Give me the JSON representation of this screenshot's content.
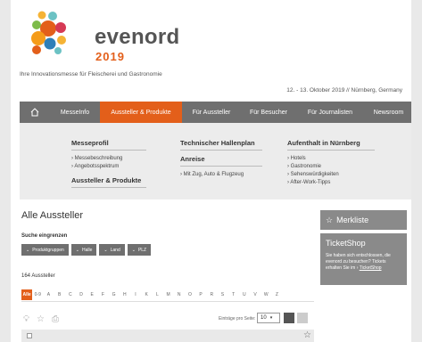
{
  "brand": {
    "name": "evenord",
    "year": "2019",
    "tagline": "Ihre Innovationsmesse für Fleischerei und Gastronomie",
    "dates": "12. - 13. Oktober 2019 // Nürnberg, Germany"
  },
  "nav": {
    "items": [
      "MesseInfo",
      "Aussteller & Produkte",
      "Für Aussteller",
      "Für Besucher",
      "Für Journalisten",
      "Newsroom"
    ]
  },
  "mega": {
    "col1": {
      "title": "Messeprofil",
      "links": [
        "Messebeschreibung",
        "Angebotsspektrum"
      ],
      "title2": "Aussteller & Produkte"
    },
    "col2": {
      "title": "Technischer Hallenplan",
      "title2": "Anreise",
      "links": [
        "Mit Zug, Auto & Flugzeug"
      ]
    },
    "col3": {
      "title": "Aufenthalt in Nürnberg",
      "links": [
        "Hotels",
        "Gastronomie",
        "Sehenswürdigkeiten",
        "After-Work-Tipps"
      ]
    }
  },
  "main": {
    "title": "Alle Aussteller",
    "filter_label": "Suche eingrenzen",
    "filters": [
      "Produktgruppen",
      "Halle",
      "Land",
      "PLZ"
    ],
    "count": "164 Aussteller",
    "alphabet": [
      "Alle",
      "0-9",
      "A",
      "B",
      "C",
      "D",
      "E",
      "F",
      "G",
      "H",
      "I",
      "K",
      "L",
      "M",
      "N",
      "O",
      "P",
      "R",
      "S",
      "T",
      "U",
      "V",
      "W",
      "Z"
    ],
    "per_page_label": "Einträge pro Seite:",
    "per_page_value": "10"
  },
  "sidebar": {
    "merkliste": "Merkliste",
    "ticket_title": "TicketShop",
    "ticket_text": "Sie haben sich entschlossen, die evenord zu besuchen? Tickets erhalten Sie im",
    "ticket_link": "TicketShop"
  },
  "icons": {
    "home": "home-icon",
    "star": "star-icon",
    "chevron": "chevron-down-icon"
  },
  "colors": {
    "accent": "#e35f1a",
    "nav": "#6f6f6f",
    "panel": "#8a8a8a"
  }
}
